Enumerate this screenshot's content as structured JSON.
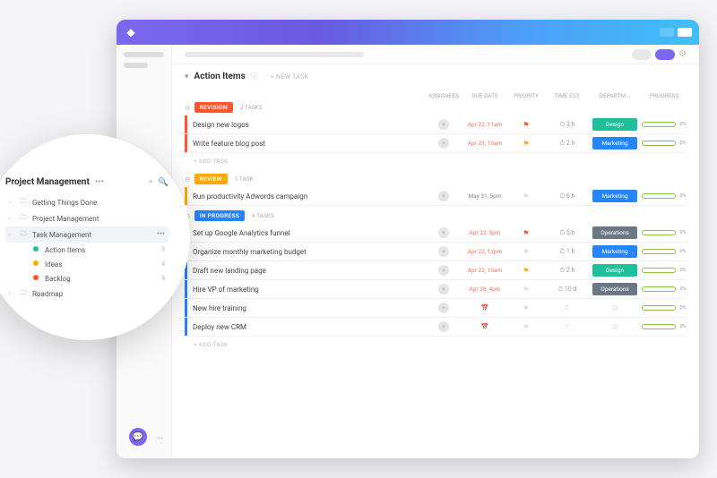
{
  "header": {
    "title": "Action Items",
    "new_task": "+ NEW TASK"
  },
  "columns": {
    "assignees": "ASSIGNEES",
    "due": "DUE DATE",
    "priority": "PRIORITY",
    "time": "TIME EST.",
    "dept": "DEPARTM...",
    "progress": "PROGRESS"
  },
  "groups": [
    {
      "status": "REVISION",
      "color": "#ff5630",
      "tasks_label": "2 TASKS",
      "tasks": [
        {
          "title": "Design new logos",
          "due": "Apr 22, 11am",
          "due_overdue": true,
          "flag": "#ff5630",
          "time": "3 h",
          "dept": "Design",
          "dept_color": "#1fbf9c",
          "progress": "0%"
        },
        {
          "title": "Write feature blog post",
          "due": "Apr 23, 10am",
          "due_overdue": true,
          "flag": "#ffab00",
          "time": "2 h",
          "dept": "Marketing",
          "dept_color": "#2684ff",
          "progress": "0%"
        }
      ],
      "add": "+ ADD TASK"
    },
    {
      "status": "REVIEW",
      "color": "#ffab00",
      "tasks_label": "1 TASK",
      "tasks": [
        {
          "title": "Run productivity Adwords campaign",
          "due": "May 31, 5pm",
          "due_overdue": false,
          "flag": "",
          "time": "6 h",
          "dept": "Marketing",
          "dept_color": "#2684ff",
          "progress": "0%"
        }
      ]
    },
    {
      "status": "IN PROGRESS",
      "color": "#2684ff",
      "tasks_label": "6 TASKS",
      "tasks": [
        {
          "title": "Set up Google Analytics funnel",
          "due": "Apr 22, 3pm",
          "due_overdue": true,
          "flag": "#ff5630",
          "time": "5 h",
          "dept": "Operations",
          "dept_color": "#6b7785",
          "progress": "0%"
        },
        {
          "title": "Organize monthly marketing budget",
          "due": "Apr 22, 12pm",
          "due_overdue": true,
          "flag": "",
          "time": "1 h",
          "dept": "Marketing",
          "dept_color": "#2684ff",
          "progress": "0%"
        },
        {
          "title": "Draft new landing page",
          "due": "Apr 22, 10am",
          "due_overdue": true,
          "flag": "#ffab00",
          "time": "2 h",
          "dept": "Design",
          "dept_color": "#1fbf9c",
          "progress": "0%"
        },
        {
          "title": "Hire VP of marketing",
          "due": "Apr 28, 4pm",
          "due_overdue": true,
          "flag": "",
          "time": "10 d",
          "dept": "Operations",
          "dept_color": "#6b7785",
          "progress": "0%"
        },
        {
          "title": "New hire training",
          "due": "",
          "due_overdue": false,
          "flag": "",
          "time": "",
          "dept": "",
          "dept_color": "",
          "progress": "0%"
        },
        {
          "title": "Deploy new CRM",
          "due": "",
          "due_overdue": false,
          "flag": "",
          "time": "",
          "dept": "",
          "dept_color": "",
          "progress": "0%"
        }
      ],
      "add": "+ ADD TASK"
    }
  ],
  "sidebar": {
    "title": "Project Management",
    "items": [
      {
        "label": "Getting Things Done",
        "type": "folder"
      },
      {
        "label": "Project Management",
        "type": "folder"
      },
      {
        "label": "Task Management",
        "type": "folder",
        "selected": true
      },
      {
        "label": "Action Items",
        "type": "list",
        "dot": "#1fbf9c",
        "count": "9"
      },
      {
        "label": "Ideas",
        "type": "list",
        "dot": "#ffab00",
        "count": "4"
      },
      {
        "label": "Backlog",
        "type": "list",
        "dot": "#ff5630",
        "count": "4"
      },
      {
        "label": "Roadmap",
        "type": "folder"
      }
    ]
  }
}
